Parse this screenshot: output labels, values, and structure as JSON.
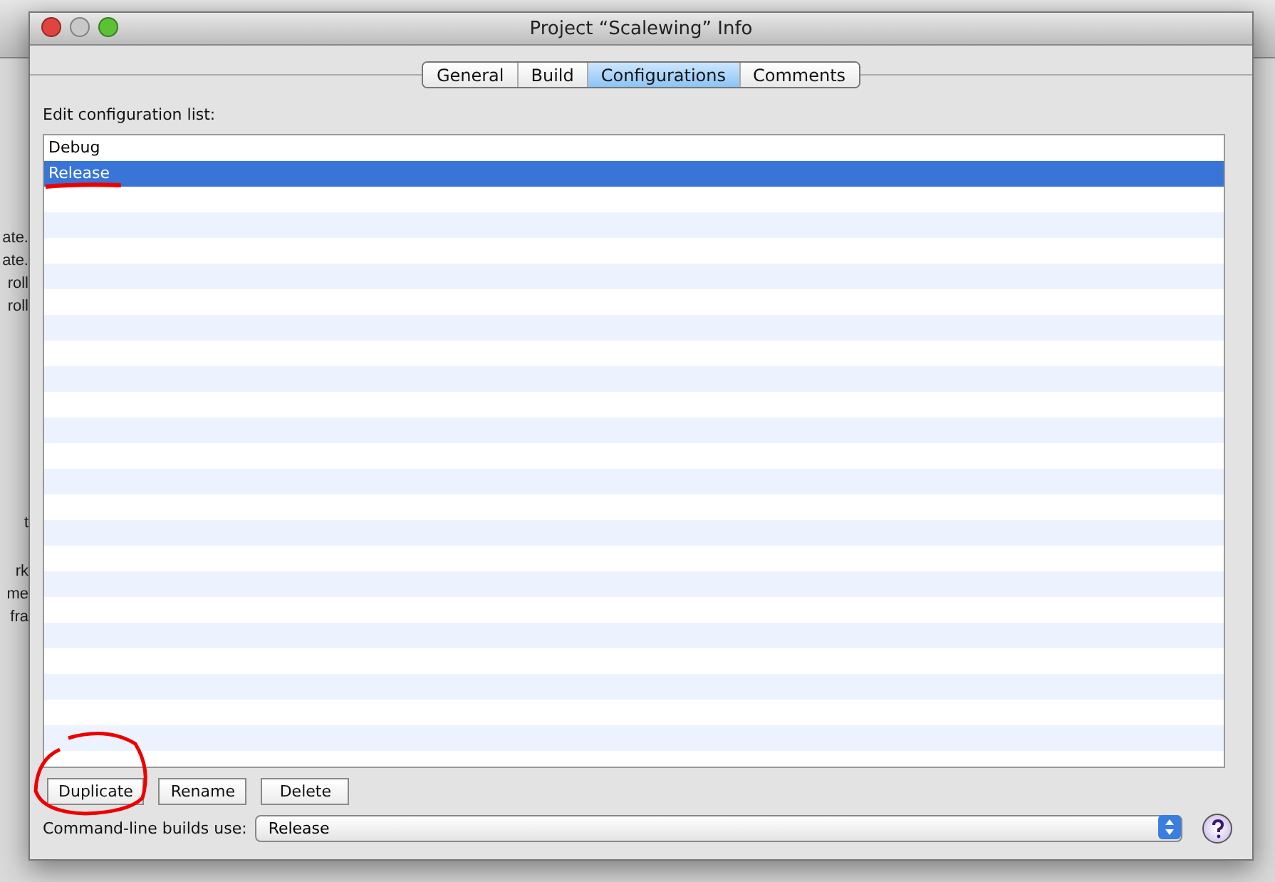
{
  "background_window": {
    "sidebar_fragments": [
      {
        "text": "ate."
      },
      {
        "text": "ate."
      },
      {
        "text": "roll"
      },
      {
        "text": "roll"
      },
      {
        "text": "t"
      },
      {
        "text": "rk"
      },
      {
        "text": "me"
      },
      {
        "text": "fra"
      }
    ]
  },
  "window": {
    "title": "Project “Scalewing” Info"
  },
  "tabs": [
    {
      "label": "General",
      "selected": false
    },
    {
      "label": "Build",
      "selected": false
    },
    {
      "label": "Configurations",
      "selected": true
    },
    {
      "label": "Comments",
      "selected": false
    }
  ],
  "list_label": "Edit configuration list:",
  "configurations": [
    {
      "name": "Debug",
      "selected": false
    },
    {
      "name": "Release",
      "selected": true
    }
  ],
  "buttons": [
    "Duplicate",
    "Rename",
    "Delete"
  ],
  "command_line": {
    "label": "Command-line builds use:",
    "value": "Release"
  }
}
